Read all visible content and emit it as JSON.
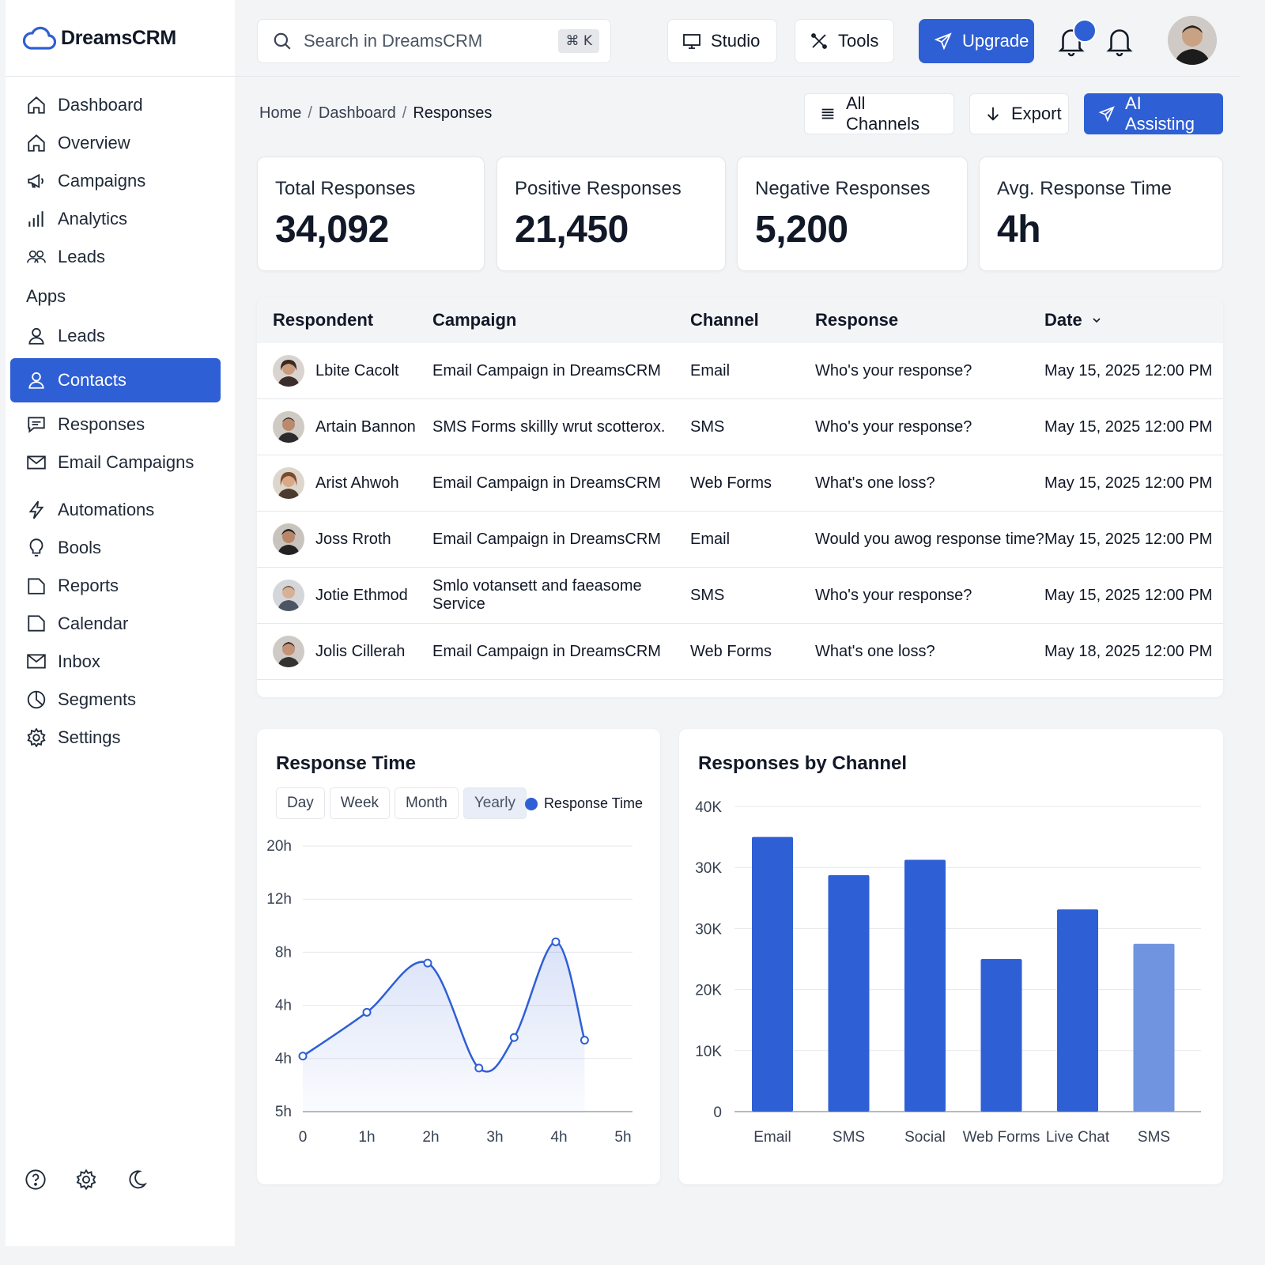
{
  "brand": {
    "name": "DreamsCRM"
  },
  "sidebar": {
    "items": [
      {
        "label": "Dashboard",
        "icon": "home-icon"
      },
      {
        "label": "Overview",
        "icon": "home-icon"
      },
      {
        "label": "Campaigns",
        "icon": "megaphone-icon"
      },
      {
        "label": "Analytics",
        "icon": "bar-chart-icon"
      },
      {
        "label": "Leads",
        "icon": "users-icon"
      }
    ],
    "section": "Apps",
    "apps": [
      {
        "label": "Leads",
        "icon": "user-icon"
      },
      {
        "label": "Contacts",
        "icon": "user-icon",
        "active": true
      },
      {
        "label": "Responses",
        "icon": "chat-icon"
      },
      {
        "label": "Email Campaigns",
        "icon": "mail-icon"
      },
      {
        "label": "Automations",
        "icon": "bolt-icon"
      },
      {
        "label": "Bools",
        "icon": "bulb-icon"
      },
      {
        "label": "Reports",
        "icon": "file-icon"
      },
      {
        "label": "Calendar",
        "icon": "file-icon"
      },
      {
        "label": "Inbox",
        "icon": "mail-icon"
      },
      {
        "label": "Segments",
        "icon": "pie-icon"
      },
      {
        "label": "Settings",
        "icon": "gear-icon"
      }
    ]
  },
  "topbar": {
    "search_placeholder": "Search in DreamsCRM",
    "search_shortcut": "⌘ K",
    "studio_label": "Studio",
    "tools_label": "Tools",
    "upgrade_label": "Upgrade"
  },
  "breadcrumb": {
    "home": "Home",
    "dashboard": "Dashboard",
    "current": "Responses"
  },
  "actions": {
    "channels_label": "All Channels",
    "export_label": "Export",
    "ai_label": "AI Assisting"
  },
  "stats": [
    {
      "label": "Total Responses",
      "value": "34,092"
    },
    {
      "label": "Positive Responses",
      "value": "21,450"
    },
    {
      "label": "Negative Responses",
      "value": "5,200"
    },
    {
      "label": "Avg. Response Time",
      "value": "4h"
    }
  ],
  "table": {
    "headers": [
      "Respondent",
      "Campaign",
      "Channel",
      "Response",
      "Date"
    ],
    "rows": [
      {
        "name": "Lbite Cacolt",
        "campaign": "Email Campaign in DreamsCRM",
        "channel": "Email",
        "response": "Who's your response?",
        "date": "May 15, 2025 12:00 PM"
      },
      {
        "name": "Artain Bannon",
        "campaign": "SMS Forms skillly wrut scotterox.",
        "channel": "SMS",
        "response": "Who's your response?",
        "date": "May 15, 2025 12:00 PM"
      },
      {
        "name": "Arist Ahwoh",
        "campaign": "Email Campaign in DreamsCRM",
        "channel": "Web Forms",
        "response": "What's one loss?",
        "date": "May 15, 2025 12:00 PM"
      },
      {
        "name": "Joss Rroth",
        "campaign": "Email Campaign in DreamsCRM",
        "channel": "Email",
        "response": "Would you awog response time?",
        "date": "May 15, 2025 12:00 PM"
      },
      {
        "name": "Jotie Ethmod",
        "campaign": "Smlo votansett and faeasome Service",
        "channel": "SMS",
        "response": "Who's your response?",
        "date": "May 15, 2025 12:00 PM"
      },
      {
        "name": "Jolis Cillerah",
        "campaign": "Email Campaign in DreamsCRM",
        "channel": "Web Forms",
        "response": "What's one loss?",
        "date": "May 18, 2025 12:00 PM"
      }
    ]
  },
  "response_time_card": {
    "title": "Response Time",
    "segments": [
      "Day",
      "Week",
      "Month",
      "Yearly"
    ],
    "active_segment": "Yearly",
    "legend": "Response Time"
  },
  "channel_card": {
    "title": "Responses by Channel"
  },
  "colors": {
    "accent": "#2f5fd4",
    "accent_light": "#7094df"
  },
  "chart_data": [
    {
      "type": "area",
      "title": "Response Time",
      "x_ticks": [
        "0",
        "1h",
        "2h",
        "3h",
        "4h",
        "5h"
      ],
      "y_ticks": [
        "20h",
        "12h",
        "8h",
        "4h",
        "4h",
        "5h"
      ],
      "series": [
        {
          "name": "Response Time",
          "x": [
            0,
            1.0,
            1.95,
            2.75,
            3.3,
            3.95,
            4.4
          ],
          "y": [
            4.3,
            7.6,
            11.3,
            3.4,
            5.7,
            12.9,
            5.5
          ]
        }
      ],
      "grid": true
    },
    {
      "type": "bar",
      "title": "Responses by Channel",
      "categories": [
        "Email",
        "SMS",
        "Social",
        "Web Forms",
        "Live Chat",
        "SMS"
      ],
      "values": [
        36000,
        31000,
        33000,
        20000,
        26500,
        22000
      ],
      "y_ticks": [
        "40K",
        "30K",
        "30K",
        "20K",
        "10K",
        "0"
      ],
      "ylim": [
        0,
        40000
      ],
      "grid": true
    }
  ]
}
